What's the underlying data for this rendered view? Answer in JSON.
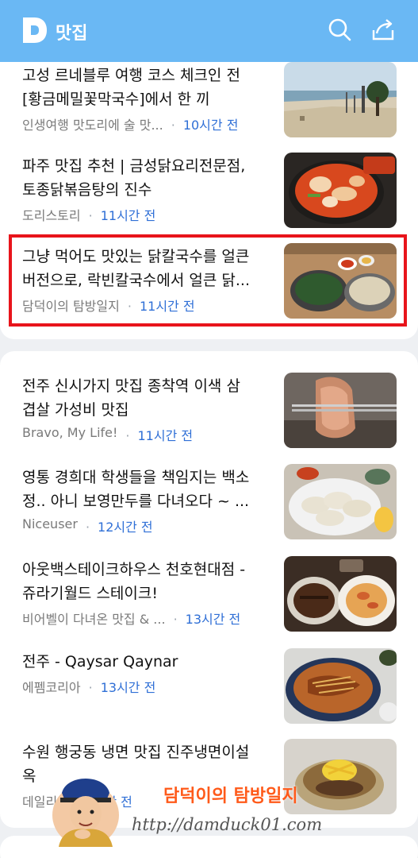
{
  "app": {
    "title": "맛집",
    "logo_letter": "D"
  },
  "icons": {
    "search": "search-icon",
    "share": "share-icon"
  },
  "colors": {
    "header": "#6ab8f4",
    "time": "#2f6fd6",
    "highlight": "#e8141b"
  },
  "feed": {
    "items": [
      {
        "title_lines": [
          "고성 르네블루 여행 코스 체크인 전",
          "[황금메밀꽃막국수]에서 한 끼"
        ],
        "source": "인생여행 맛도리에 술 맛...",
        "time": "10시간 전",
        "thumb": "beach"
      },
      {
        "title_lines": [
          "파주 맛집 추천 | 금성닭요리전문점,",
          "토종닭볶음탕의 진수"
        ],
        "source": "도리스토리",
        "time": "11시간 전",
        "thumb": "stew"
      },
      {
        "title_lines": [
          "그냥 먹어도 맛있는 닭칼국수를 얼큰",
          "버전으로, 락빈칼국수에서 얼큰 닭..."
        ],
        "source": "담덕이의 탐방일지",
        "time": "11시간 전",
        "thumb": "noodle"
      },
      {
        "title_lines": [
          "전주 신시가지 맛집 종착역 이색 삼",
          "겹살 가성비 맛집"
        ],
        "source": "Bravo, My Life!",
        "time": "11시간 전",
        "thumb": "pork"
      },
      {
        "title_lines": [
          "영통 경희대 학생들을 책임지는 백소",
          "정.. 아니 보영만두를 다녀오다 ~ ..."
        ],
        "source": "Niceuser",
        "time": "12시간 전",
        "thumb": "dumpling"
      },
      {
        "title_lines": [
          "아웃백스테이크하우스 천호현대점 -",
          "쥬라기월드 스테이크!"
        ],
        "source": "비어벨이 다녀온 맛집 & ...",
        "time": "13시간 전",
        "thumb": "steak"
      },
      {
        "title_lines": [
          "전주 - Qaysar Qaynar"
        ],
        "source": "에펨코리아",
        "time": "13시간 전",
        "thumb": "plov"
      },
      {
        "title_lines": [
          "수원 행궁동 냉면 맛집 진주냉면이설",
          "옥"
        ],
        "source": "데일리",
        "time": "13시간 전",
        "thumb": "coldnoodle"
      }
    ]
  },
  "watermark": {
    "title": "담덕이의 탐방일지",
    "url": "http://damduck01.com"
  }
}
